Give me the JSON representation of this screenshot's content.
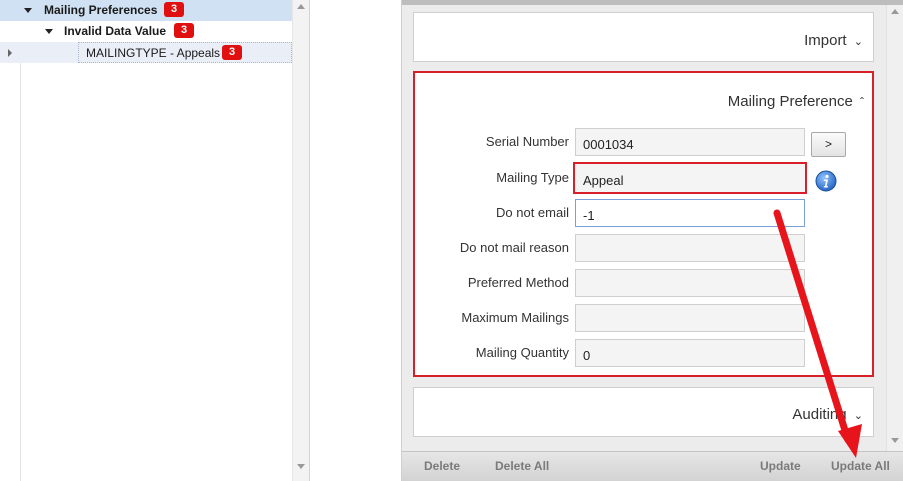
{
  "tree": {
    "items": [
      {
        "label": "Mailing Preferences",
        "badge": "3"
      },
      {
        "label": "Invalid Data Value",
        "badge": "3"
      },
      {
        "label": "MAILINGTYPE - Appeals",
        "badge": "3"
      }
    ]
  },
  "panels": {
    "import_title": "Import",
    "mailing_title": "Mailing Preference",
    "auditing_title": "Auditing"
  },
  "form": {
    "serial_number": {
      "label": "Serial Number",
      "value": "0001034"
    },
    "serial_button": ">",
    "mailing_type": {
      "label": "Mailing Type",
      "value": "Appeal"
    },
    "do_not_email": {
      "label": "Do not email",
      "value": "-1"
    },
    "do_not_mail_reason": {
      "label": "Do not mail reason",
      "value": ""
    },
    "preferred_method": {
      "label": "Preferred Method",
      "value": ""
    },
    "maximum_mailings": {
      "label": "Maximum Mailings",
      "value": ""
    },
    "mailing_quantity": {
      "label": "Mailing Quantity",
      "value": "0"
    }
  },
  "toolbar": {
    "delete": "Delete",
    "delete_all": "Delete All",
    "update": "Update",
    "update_all": "Update All"
  },
  "colors": {
    "highlight_red": "#d9202a",
    "badge_red": "#e01010",
    "tree_selected": "#cfe1f3"
  }
}
